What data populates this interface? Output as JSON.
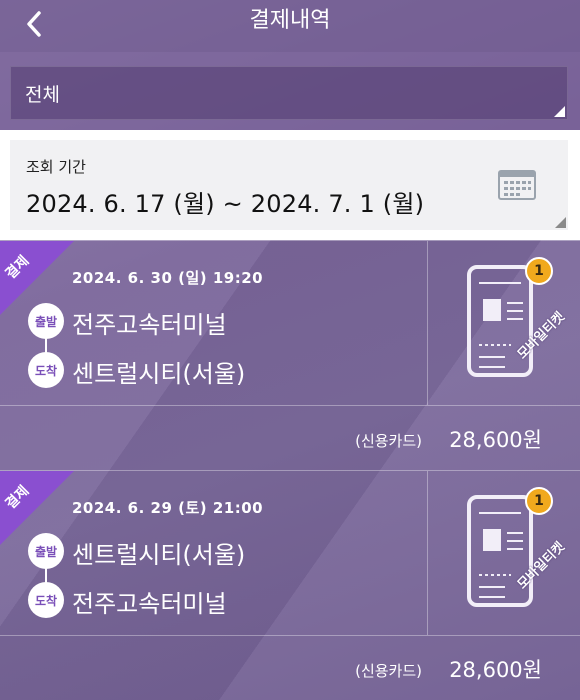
{
  "header": {
    "title": "결제내역",
    "back_icon": "chevron-left-icon"
  },
  "filter": {
    "selected": "전체"
  },
  "period": {
    "label": "조회 기간",
    "value": "2024. 6. 17 (월) ~ 2024. 7. 1 (월)",
    "icon": "calendar-icon"
  },
  "payments": [
    {
      "status": "결제",
      "datetime": "2024. 6. 30 (일) 19:20",
      "departure_badge": "출발",
      "departure": "전주고속터미널",
      "arrival_badge": "도착",
      "arrival": "센트럴시티(서울)",
      "ticket_count": "1",
      "ticket_label": "모바일티켓",
      "pay_method": "(신용카드)",
      "amount": "28,600원"
    },
    {
      "status": "결제",
      "datetime": "2024. 6. 29 (토) 21:00",
      "departure_badge": "출발",
      "departure": "센트럴시티(서울)",
      "arrival_badge": "도착",
      "arrival": "전주고속터미널",
      "ticket_count": "1",
      "ticket_label": "모바일티켓",
      "pay_method": "(신용카드)",
      "amount": "28,600원"
    }
  ],
  "colors": {
    "ribbon": "#8a4fd0",
    "badge_count": "#f1a91d",
    "badge_text": "#7a4fb8"
  }
}
